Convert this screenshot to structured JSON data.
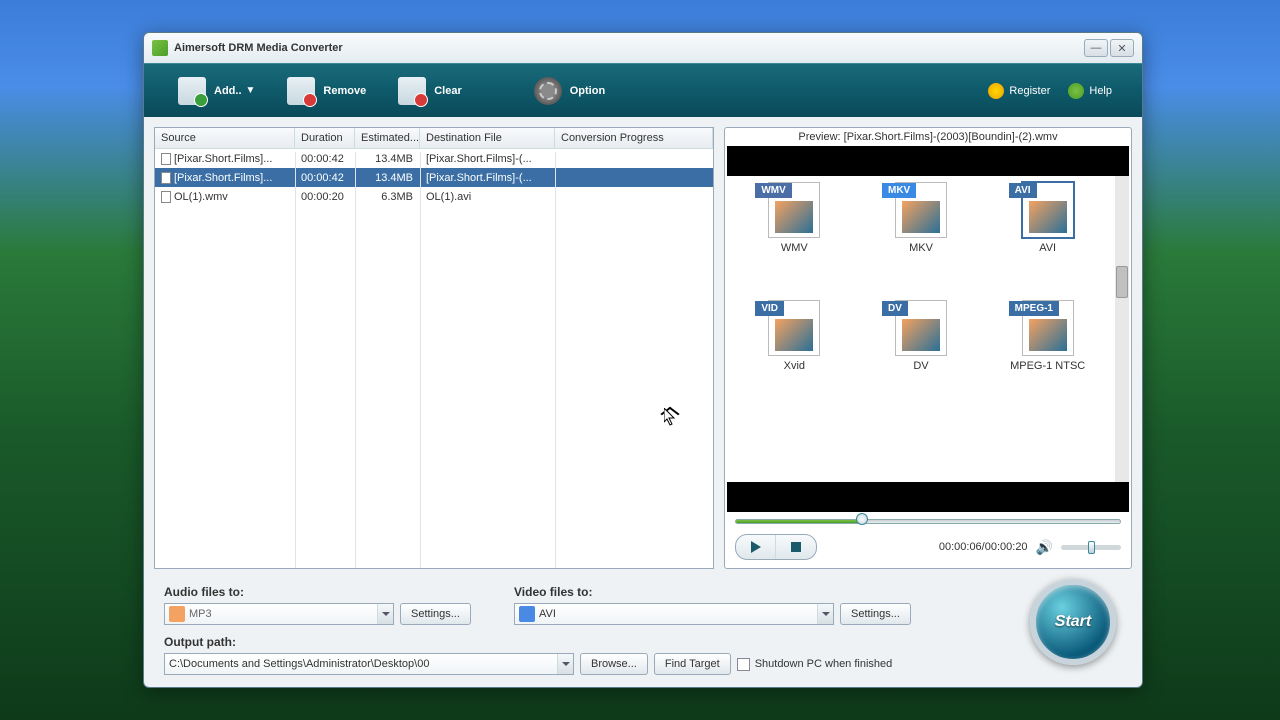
{
  "title": "Aimersoft DRM Media Converter",
  "toolbar": {
    "add": "Add..",
    "remove": "Remove",
    "clear": "Clear",
    "option": "Option",
    "register": "Register",
    "help": "Help"
  },
  "columns": {
    "source": "Source",
    "duration": "Duration",
    "estimated": "Estimated...",
    "destination": "Destination File",
    "progress": "Conversion Progress"
  },
  "files": [
    {
      "source": "[Pixar.Short.Films]...",
      "duration": "00:00:42",
      "estimated": "13.4MB",
      "destination": "[Pixar.Short.Films]-(...",
      "selected": false
    },
    {
      "source": "[Pixar.Short.Films]...",
      "duration": "00:00:42",
      "estimated": "13.4MB",
      "destination": "[Pixar.Short.Films]-(...",
      "selected": true
    },
    {
      "source": "OL(1).wmv",
      "duration": "00:00:20",
      "estimated": "6.3MB",
      "destination": "OL(1).avi",
      "selected": false
    }
  ],
  "preview": {
    "title": "Preview: [Pixar.Short.Films]-(2003)[Boundin]-(2).wmv",
    "time": "00:00:06/00:00:20"
  },
  "formats": [
    {
      "tag": "WMV",
      "label": "WMV",
      "color": "#4a6ea5"
    },
    {
      "tag": "MKV",
      "label": "MKV",
      "color": "#3a8ae5"
    },
    {
      "tag": "AVI",
      "label": "AVI",
      "color": "#3a6ea5",
      "sel": true
    },
    {
      "tag": "VID",
      "label": "Xvid",
      "color": "#3a6ea5"
    },
    {
      "tag": "DV",
      "label": "DV",
      "color": "#3a6ea5"
    },
    {
      "tag": "MPEG-1",
      "label": "MPEG-1 NTSC",
      "color": "#3a6ea5"
    }
  ],
  "bottom": {
    "audio_label": "Audio files to:",
    "audio_value": "MP3",
    "video_label": "Video files to:",
    "video_value": "AVI",
    "settings": "Settings...",
    "output_label": "Output path:",
    "output_value": "C:\\Documents and Settings\\Administrator\\Desktop\\00",
    "browse": "Browse...",
    "find_target": "Find Target",
    "shutdown": "Shutdown PC when finished",
    "start": "Start"
  }
}
